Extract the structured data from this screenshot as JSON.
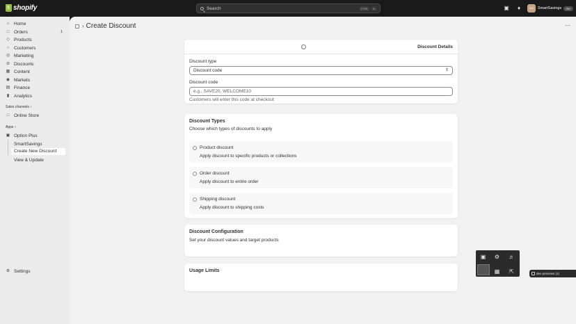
{
  "topbar": {
    "logo_text": "shopify",
    "search_placeholder": "Search",
    "kbd_ctrl": "CTRL",
    "kbd_k": "K",
    "store_avatar": "Sm",
    "store_name": "SmartSavings",
    "store_tag": "dev"
  },
  "sidebar": {
    "items": [
      {
        "label": "Home",
        "icon": "home-icon"
      },
      {
        "label": "Orders",
        "icon": "orders-icon",
        "badge": "1"
      },
      {
        "label": "Products",
        "icon": "tag-icon"
      },
      {
        "label": "Customers",
        "icon": "person-icon"
      },
      {
        "label": "Marketing",
        "icon": "target-icon"
      },
      {
        "label": "Discounts",
        "icon": "discount-icon"
      },
      {
        "label": "Content",
        "icon": "content-icon"
      },
      {
        "label": "Markets",
        "icon": "globe-icon"
      },
      {
        "label": "Finance",
        "icon": "bank-icon"
      },
      {
        "label": "Analytics",
        "icon": "chart-icon"
      }
    ],
    "sales_channels": "Sales channels",
    "online_store": "Online Store",
    "apps": "Apps",
    "option_plus": "Option Plus",
    "smartsavings": "SmartSavings",
    "create_new_discount": "Create New Discount",
    "view_update": "View & Update",
    "settings": "Settings"
  },
  "header": {
    "title": "Create Discount"
  },
  "details_card": {
    "heading": "Discount Details",
    "type_label": "Discount type",
    "type_value": "Discount code",
    "code_label": "Discount code",
    "code_placeholder": "e.g., SAVE20, WELCOME10",
    "code_help": "Customers will enter this code at checkout"
  },
  "types_card": {
    "title": "Discount Types",
    "subtitle": "Choose which types of discounts to apply",
    "options": [
      {
        "title": "Product discount",
        "desc": "Apply discount to specific products or collections"
      },
      {
        "title": "Order discount",
        "desc": "Apply discount to entire order"
      },
      {
        "title": "Shipping discount",
        "desc": "Apply discount to shipping costs"
      }
    ]
  },
  "config_card": {
    "title": "Discount Configuration",
    "subtitle": "Set your discount values and target products"
  },
  "usage_card": {
    "title": "Usage Limits"
  },
  "dev_preview": {
    "label": "dev previews (1)"
  }
}
